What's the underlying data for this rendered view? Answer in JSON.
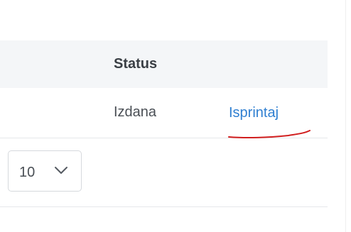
{
  "table": {
    "header": {
      "status_label": "Status"
    },
    "rows": [
      {
        "status": "Izdana",
        "action_label": "Isprintaj"
      }
    ]
  },
  "pagination": {
    "page_size_value": "10"
  },
  "colors": {
    "link": "#2f7fd1",
    "annotation_underline": "#d11f1f",
    "header_bg": "#f4f6f8"
  },
  "icons": {
    "select_chevron": "chevron-down-icon"
  }
}
